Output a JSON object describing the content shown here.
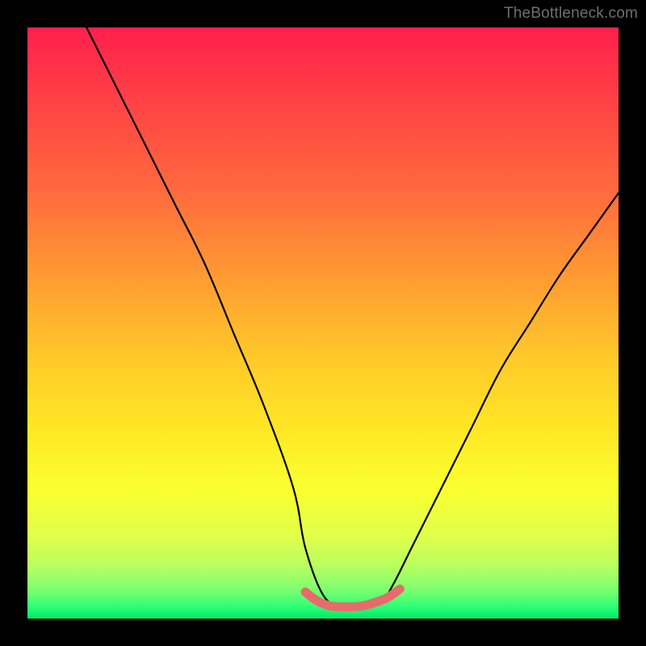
{
  "watermark": "TheBottleneck.com",
  "chart_data": {
    "type": "line",
    "title": "",
    "xlabel": "",
    "ylabel": "",
    "xlim": [
      0,
      100
    ],
    "ylim": [
      0,
      100
    ],
    "grid": false,
    "legend": false,
    "annotations": [],
    "colors": {
      "curve": "#000000",
      "highlight": "#e86a6a",
      "background_gradient_top": "#ff1f4d",
      "background_gradient_bottom": "#00e86a"
    },
    "series": [
      {
        "name": "bottleneck-curve",
        "x": [
          10,
          15,
          20,
          25,
          30,
          35,
          40,
          45,
          47,
          50,
          53,
          55,
          57,
          60,
          62,
          65,
          70,
          75,
          80,
          85,
          90,
          95,
          100
        ],
        "y": [
          100,
          90,
          80,
          70,
          60,
          48,
          36,
          22,
          12,
          4,
          2,
          2,
          2,
          3,
          6,
          12,
          22,
          32,
          42,
          50,
          58,
          65,
          72
        ]
      },
      {
        "name": "optimal-range-highlight",
        "x": [
          47,
          49,
          51,
          53,
          55,
          57,
          59,
          61,
          63
        ],
        "y": [
          4.5,
          3.0,
          2.2,
          2.0,
          2.0,
          2.2,
          2.8,
          3.6,
          5.0
        ]
      }
    ]
  }
}
